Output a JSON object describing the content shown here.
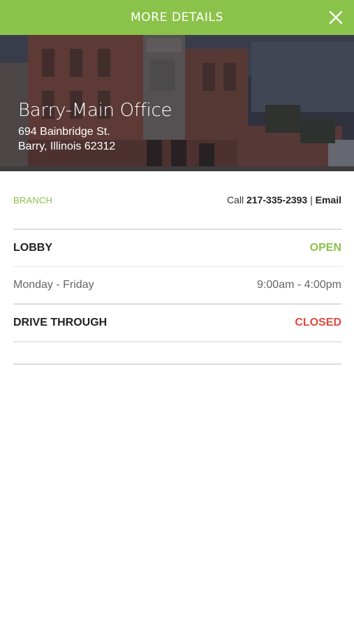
{
  "header": {
    "title": "MORE DETAILS",
    "close_icon": "close-icon"
  },
  "hero": {
    "name": "Barry-Main Office",
    "address_line1": "694 Bainbridge St.",
    "address_line2": "Barry, Illinois 62312"
  },
  "info": {
    "type": "BRANCH",
    "call_label": "Call",
    "phone": "217-335-2393",
    "separator": "|",
    "email_label": "Email"
  },
  "hours": [
    {
      "title": "LOBBY",
      "status": "OPEN",
      "rows": [
        {
          "days": "Monday - Friday",
          "time": "9:00am - 4:00pm"
        }
      ]
    },
    {
      "title": "DRIVE THROUGH",
      "status": "CLOSED",
      "rows": []
    }
  ],
  "colors": {
    "accent": "#8bc34a",
    "closed": "#e0493e"
  }
}
